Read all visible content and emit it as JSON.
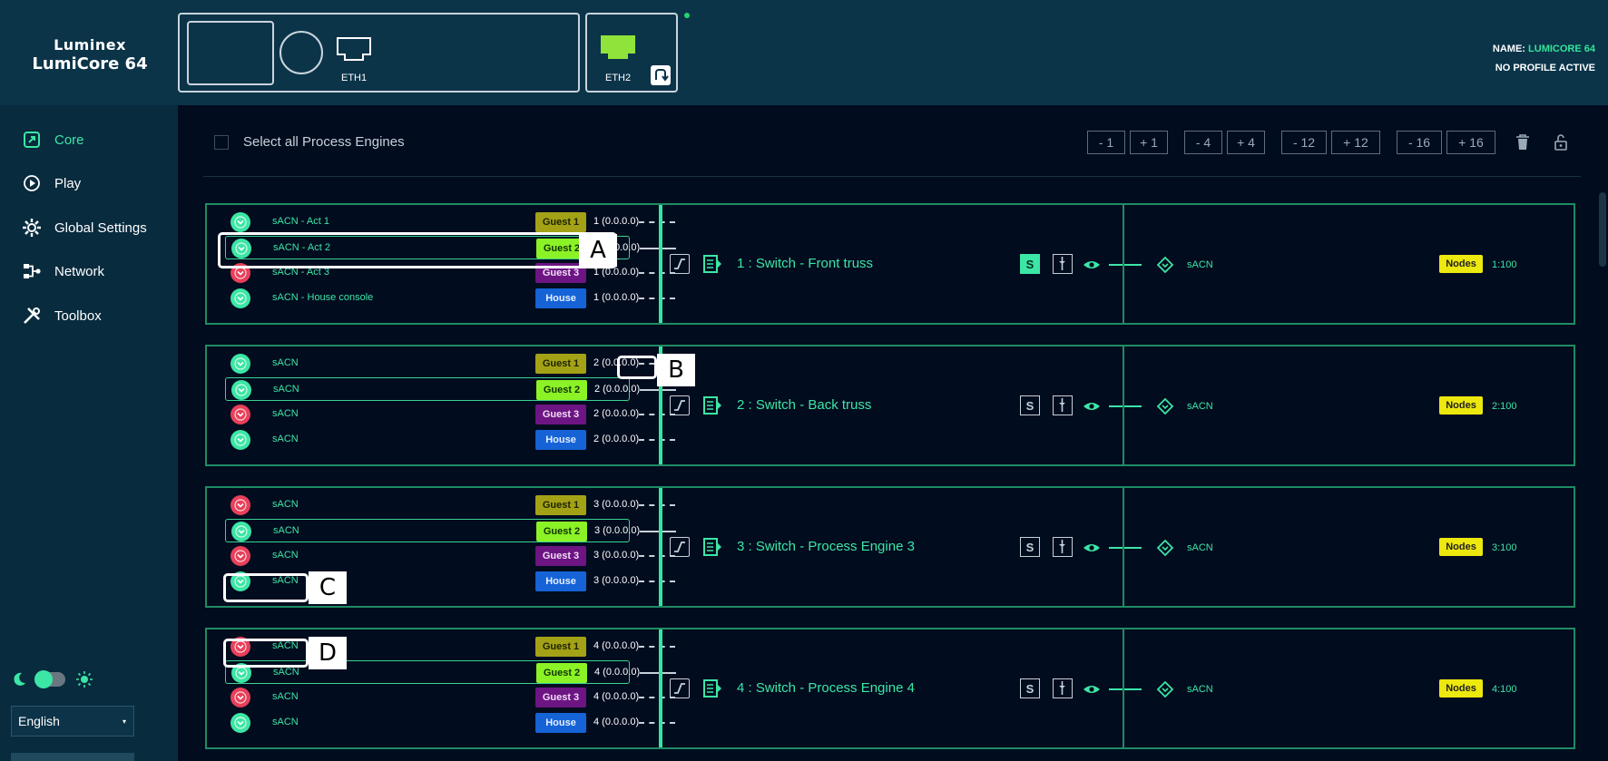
{
  "app": {
    "brand_line1": "Luminex",
    "brand_line2": "LumiCore 64"
  },
  "header": {
    "eth1_label": "ETH1",
    "eth2_label": "ETH2",
    "name_label": "NAME:",
    "name_value": "LUMICORE 64",
    "profile_status": "NO PROFILE ACTIVE"
  },
  "sidebar": {
    "items": [
      {
        "label": "Core",
        "icon": "core-icon",
        "active": true
      },
      {
        "label": "Play",
        "icon": "play-icon"
      },
      {
        "label": "Global Settings",
        "icon": "gear-icon"
      },
      {
        "label": "Network",
        "icon": "network-icon"
      },
      {
        "label": "Toolbox",
        "icon": "tools-icon"
      }
    ],
    "language": "English"
  },
  "main": {
    "select_all_label": "Select all Process Engines",
    "toolbar": [
      "- 1",
      "+ 1",
      "- 4",
      "+ 4",
      "- 12",
      "+ 12",
      "- 16",
      "+ 16"
    ]
  },
  "engines": [
    {
      "title": "1 : Switch - Front truss",
      "s_active": true,
      "out_proto": "sACN",
      "nodes_label": "Nodes",
      "out_univ": "1:100",
      "sources": [
        {
          "name": "sACN - Act 1",
          "prio": "Guest 1",
          "univ": "1 (0.0.0.0)",
          "status": "ok"
        },
        {
          "name": "sACN - Act 2",
          "prio": "Guest 2",
          "univ": "1 (0.0.0.0)",
          "status": "ok"
        },
        {
          "name": "sACN - Act 3",
          "prio": "Guest 3",
          "univ": "1 (0.0.0.0)",
          "status": "err"
        },
        {
          "name": "sACN - House console",
          "prio": "House",
          "univ": "1 (0.0.0.0)",
          "status": "ok"
        }
      ]
    },
    {
      "title": "2 : Switch - Back truss",
      "s_active": false,
      "out_proto": "sACN",
      "nodes_label": "Nodes",
      "out_univ": "2:100",
      "sources": [
        {
          "name": "sACN",
          "prio": "Guest 1",
          "univ": "2 (0.0.0.0)",
          "status": "ok"
        },
        {
          "name": "sACN",
          "prio": "Guest 2",
          "univ": "2 (0.0.0.0)",
          "status": "ok"
        },
        {
          "name": "sACN",
          "prio": "Guest 3",
          "univ": "2 (0.0.0.0)",
          "status": "err"
        },
        {
          "name": "sACN",
          "prio": "House",
          "univ": "2 (0.0.0.0)",
          "status": "ok"
        }
      ]
    },
    {
      "title": "3 : Switch - Process Engine 3",
      "s_active": false,
      "out_proto": "sACN",
      "nodes_label": "Nodes",
      "out_univ": "3:100",
      "sources": [
        {
          "name": "sACN",
          "prio": "Guest 1",
          "univ": "3 (0.0.0.0)",
          "status": "err"
        },
        {
          "name": "sACN",
          "prio": "Guest 2",
          "univ": "3 (0.0.0.0)",
          "status": "ok"
        },
        {
          "name": "sACN",
          "prio": "Guest 3",
          "univ": "3 (0.0.0.0)",
          "status": "err"
        },
        {
          "name": "sACN",
          "prio": "House",
          "univ": "3 (0.0.0.0)",
          "status": "ok"
        }
      ]
    },
    {
      "title": "4 : Switch - Process Engine 4",
      "s_active": false,
      "out_proto": "sACN",
      "nodes_label": "Nodes",
      "out_univ": "4:100",
      "sources": [
        {
          "name": "sACN",
          "prio": "Guest 1",
          "univ": "4 (0.0.0.0)",
          "status": "err"
        },
        {
          "name": "sACN",
          "prio": "Guest 2",
          "univ": "4 (0.0.0.0)",
          "status": "ok"
        },
        {
          "name": "sACN",
          "prio": "Guest 3",
          "univ": "4 (0.0.0.0)",
          "status": "err"
        },
        {
          "name": "sACN",
          "prio": "House",
          "univ": "4 (0.0.0.0)",
          "status": "ok"
        }
      ]
    }
  ],
  "callouts": [
    "A",
    "B",
    "C",
    "D"
  ],
  "colors": {
    "accent": "#3ce6a5",
    "error": "#e8405a",
    "header_bg": "#0b3449",
    "main_bg": "#020c1f"
  }
}
